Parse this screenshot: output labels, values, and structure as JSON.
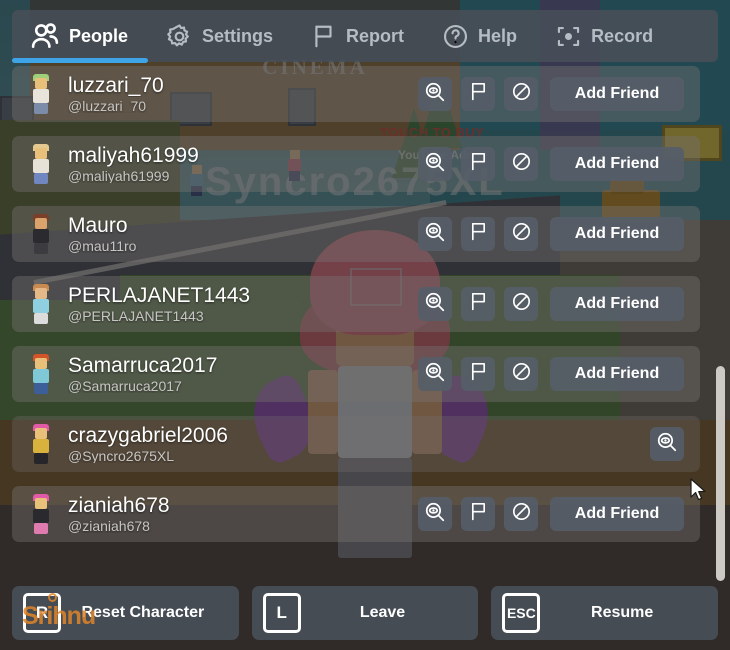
{
  "scene": {
    "cinema_sign": "CINEMA",
    "nametag": "Syncro2675XL",
    "touch_text": "TOUCH TO BUY",
    "admin_text": "YouTube Admin"
  },
  "tabs": [
    {
      "label": "People",
      "icon": "people-icon",
      "active": true
    },
    {
      "label": "Settings",
      "icon": "gear-icon",
      "active": false
    },
    {
      "label": "Report",
      "icon": "flag-icon",
      "active": false
    },
    {
      "label": "Help",
      "icon": "question-icon",
      "active": false
    },
    {
      "label": "Record",
      "icon": "record-icon",
      "active": false
    }
  ],
  "actions": {
    "inspect_icon": "magnifier-eye-icon",
    "report_icon": "flag-icon",
    "block_icon": "block-icon",
    "add_friend_label": "Add Friend"
  },
  "players": [
    {
      "display": "luzzari_70",
      "username": "@luzzari_70",
      "self": false,
      "avatar": {
        "hair": "#9fd17a",
        "head": "#e8c07a",
        "body": "#e8e4dc",
        "legs": "#7a8ca8"
      }
    },
    {
      "display": "maliyah61999",
      "username": "@maliyah61999",
      "self": false,
      "avatar": {
        "hair": "#e3c98f",
        "head": "#e8c07a",
        "body": "#e6e2d8",
        "legs": "#6f86c0"
      }
    },
    {
      "display": "Mauro",
      "username": "@mau11ro",
      "self": false,
      "avatar": {
        "hair": "#7a3f2a",
        "head": "#d9a36b",
        "body": "#2b2b2f",
        "legs": "#3b3b40"
      }
    },
    {
      "display": "PERLAJANET1443",
      "username": "@PERLAJANET1443",
      "self": false,
      "avatar": {
        "hair": "#c98a52",
        "head": "#e5b888",
        "body": "#8fd0e0",
        "legs": "#dcdcdc"
      }
    },
    {
      "display": "Samarruca2017",
      "username": "@Samarruca2017",
      "self": false,
      "avatar": {
        "hair": "#d4542a",
        "head": "#e8c07a",
        "body": "#7fc8d8",
        "legs": "#3c5f9a"
      }
    },
    {
      "display": "crazygabriel2006",
      "username": "@Syncro2675XL",
      "self": true,
      "avatar": {
        "hair": "#e05aa8",
        "head": "#e8c07a",
        "body": "#d8b23c",
        "legs": "#26262a"
      }
    },
    {
      "display": "zianiah678",
      "username": "@zianiah678",
      "self": false,
      "avatar": {
        "hair": "#e05aa8",
        "head": "#e8c07a",
        "body": "#2a2a2e",
        "legs": "#e07bb0"
      }
    }
  ],
  "bottom_buttons": [
    {
      "key": "R",
      "label": "Reset Character"
    },
    {
      "key": "L",
      "label": "Leave"
    },
    {
      "key": "ESC",
      "label": "Resume"
    }
  ],
  "watermark": {
    "text": "Srihnu"
  },
  "colors": {
    "accent": "#3fa3e8",
    "panel": "#484f58",
    "button": "#565d68",
    "text": "#ffffff",
    "muted": "#c8c6c4",
    "scrollbar": "#cdc9c5"
  }
}
